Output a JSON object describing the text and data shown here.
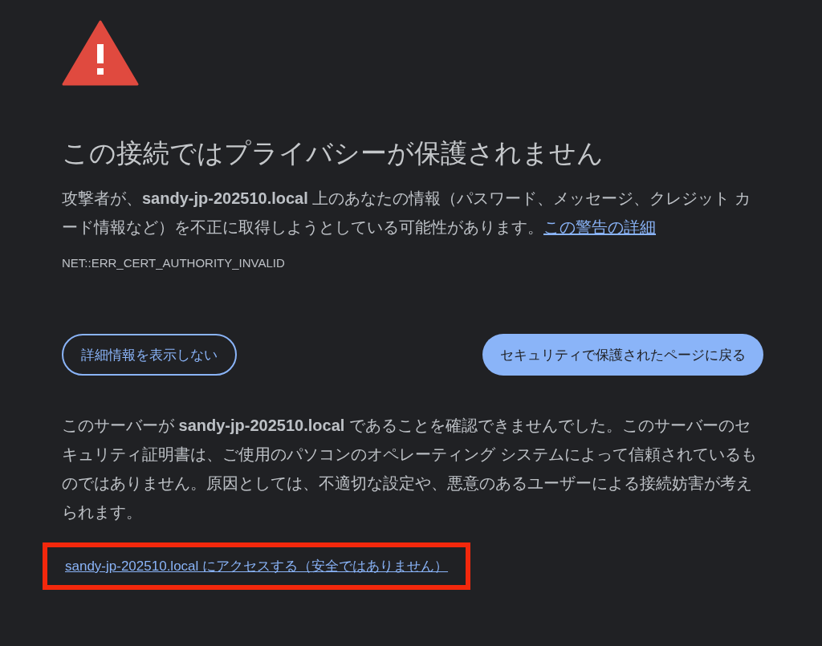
{
  "heading": "この接続ではプライバシーが保護されません",
  "description": {
    "text": "攻撃者が、**sandy-jp-202510.local** 上のあなたの情報（パスワード、メッセージ、クレジット カード情報など）を不正に取得しようとしている可能性があります。",
    "link": "この警告の詳細"
  },
  "error_code": "NET::ERR_CERT_AUTHORITY_INVALID",
  "buttons": [
    {
      "label": "詳細情報を表示しない",
      "kind": "outline"
    },
    {
      "label": "セキュリティで保護されたページに戻る",
      "kind": "primary"
    }
  ],
  "details": "このサーバーが **sandy-jp-202510.local** であることを確認できませんでした。このサーバーのセキュリティ証明書は、ご使用のパソコンのオペレーティング システムによって信頼されているものではありません。原因としては、不適切な設定や、悪意のあるユーザーによる接続妨害が考えられます。",
  "proceed_link": {
    "text": "sandy-jp-202510.local にアクセスする（安全ではありません）",
    "highlighted": true
  }
}
